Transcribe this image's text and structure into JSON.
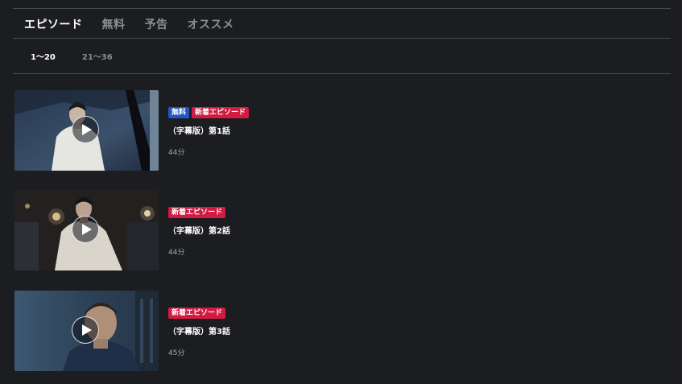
{
  "tabs": [
    {
      "label": "エピソード",
      "active": true
    },
    {
      "label": "無料",
      "active": false
    },
    {
      "label": "予告",
      "active": false
    },
    {
      "label": "オススメ",
      "active": false
    }
  ],
  "ranges": [
    {
      "label": "1〜20",
      "active": true
    },
    {
      "label": "21〜36",
      "active": false
    }
  ],
  "episodes": [
    {
      "badges": {
        "free": "無料",
        "new": "新着エピソード"
      },
      "title": "（字幕版）第1話",
      "duration": "44分"
    },
    {
      "badges": {
        "new": "新着エピソード"
      },
      "title": "（字幕版）第2話",
      "duration": "44分"
    },
    {
      "badges": {
        "new": "新着エピソード"
      },
      "title": "（字幕版）第3話",
      "duration": "45分"
    }
  ],
  "colors": {
    "background": "#1c1d21",
    "free_badge": "#1f57c3",
    "new_badge": "#d11b42",
    "divider": "#4a4b50"
  }
}
